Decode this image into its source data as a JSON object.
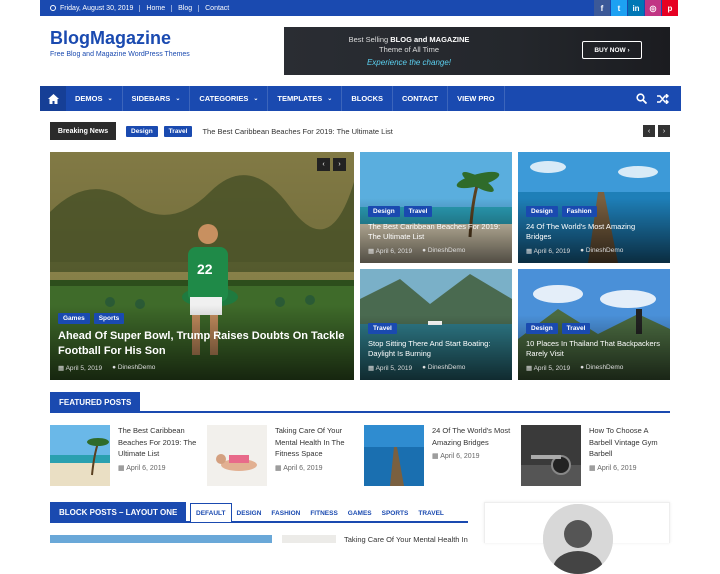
{
  "topbar": {
    "date": "Friday, August 30, 2019",
    "links": [
      "Home",
      "Blog",
      "Contact"
    ],
    "social": [
      {
        "icon": "facebook-icon",
        "glyph": "f",
        "color": "#3b5998"
      },
      {
        "icon": "twitter-icon",
        "glyph": "t",
        "color": "#1da1f2"
      },
      {
        "icon": "linkedin-icon",
        "glyph": "in",
        "color": "#0077b5"
      },
      {
        "icon": "instagram-icon",
        "glyph": "◎",
        "color": "#c13584"
      },
      {
        "icon": "pinterest-icon",
        "glyph": "p",
        "color": "#e60023"
      }
    ]
  },
  "header": {
    "title": "BlogMagazine",
    "subtitle": "Free Blog and Magazine WordPress Themes",
    "banner": {
      "line1_pre": "Best Selling ",
      "line1_bold": "BLOG and MAGAZINE",
      "line2": "Theme of All Time",
      "line3": "Experience the change!",
      "button": "BUY NOW ›"
    }
  },
  "nav": {
    "items": [
      {
        "label": "DEMOS",
        "dropdown": true
      },
      {
        "label": "SIDEBARS",
        "dropdown": true
      },
      {
        "label": "CATEGORIES",
        "dropdown": true
      },
      {
        "label": "TEMPLATES",
        "dropdown": true
      },
      {
        "label": "BLOCKS",
        "dropdown": false
      },
      {
        "label": "CONTACT",
        "dropdown": false
      },
      {
        "label": "VIEW PRO",
        "dropdown": false
      }
    ]
  },
  "breaking": {
    "label": "Breaking News",
    "tags": [
      "Design",
      "Travel"
    ],
    "text": "The Best Caribbean Beaches For 2019: The Ultimate List"
  },
  "hero": {
    "main": {
      "tags": [
        "Games",
        "Sports"
      ],
      "title": "Ahead Of Super Bowl, Trump Raises Doubts On Tackle Football For His Son",
      "date": "April 5, 2019",
      "author": "DineshDemo"
    },
    "grid": [
      {
        "tags": [
          "Design",
          "Travel"
        ],
        "title": "The Best Caribbean Beaches For 2019: The Ultimate List",
        "date": "April 6, 2019",
        "author": "DineshDemo"
      },
      {
        "tags": [
          "Design",
          "Fashion"
        ],
        "title": "24 Of The World's Most Amazing Bridges",
        "date": "April 6, 2019",
        "author": "DineshDemo"
      },
      {
        "tags": [
          "Travel"
        ],
        "title": "Stop Sitting There And Start Boating: Daylight Is Burning",
        "date": "April 5, 2019",
        "author": "DineshDemo"
      },
      {
        "tags": [
          "Design",
          "Travel"
        ],
        "title": "10 Places In Thailand That Backpackers Rarely Visit",
        "date": "April 5, 2019",
        "author": "DineshDemo"
      }
    ]
  },
  "featured": {
    "heading": "FEATURED POSTS",
    "posts": [
      {
        "title": "The Best Caribbean Beaches For 2019: The Ultimate List",
        "date": "April 6, 2019"
      },
      {
        "title": "Taking Care Of Your Mental Health In The Fitness Space",
        "date": "April 6, 2019"
      },
      {
        "title": "24 Of The World's Most Amazing Bridges",
        "date": "April 6, 2019"
      },
      {
        "title": "How To Choose A Barbell Vintage Gym Barbell",
        "date": "April 6, 2019"
      }
    ]
  },
  "block": {
    "heading": "BLOCK POSTS – LAYOUT ONE",
    "tabs": [
      "DEFAULT",
      "DESIGN",
      "FASHION",
      "FITNESS",
      "GAMES",
      "SPORTS",
      "TRAVEL"
    ],
    "peek_title": "Taking Care Of Your Mental Health In"
  }
}
